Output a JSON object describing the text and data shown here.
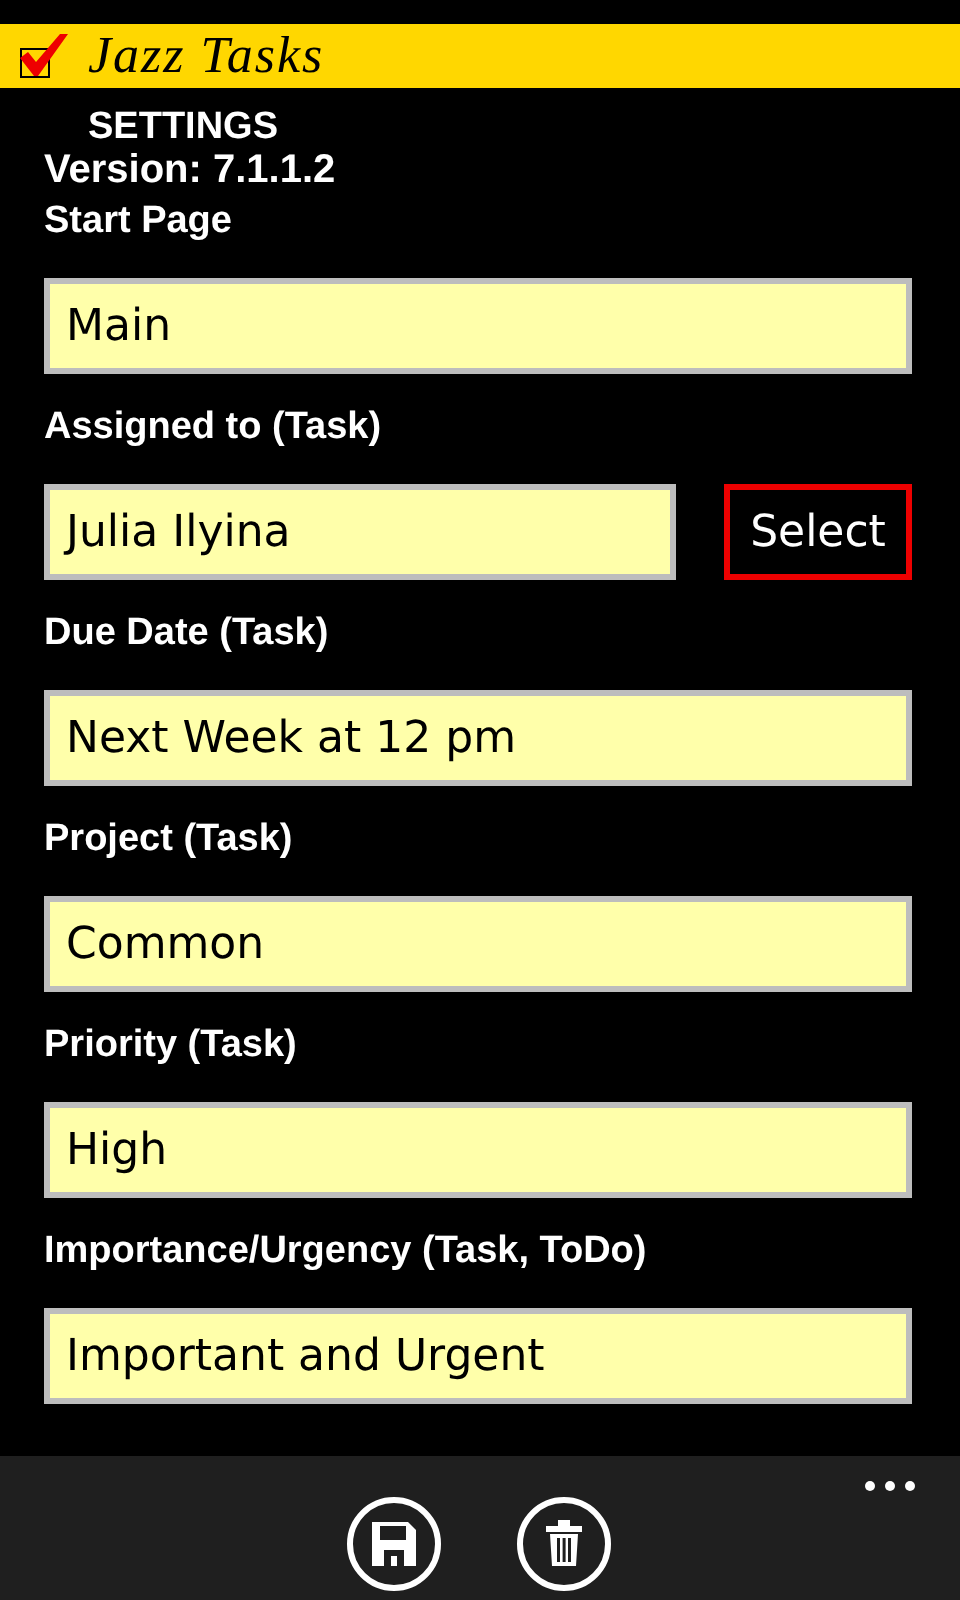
{
  "title_bar": {
    "title": "Jazz Tasks"
  },
  "heading": "SETTINGS",
  "version": "Version: 7.1.1.2",
  "fields": [
    {
      "kind": "text",
      "label": "Start Page",
      "value": "Main"
    },
    {
      "kind": "select",
      "label": "Assigned to (Task)",
      "value": "Julia Ilyina",
      "button": "Select"
    },
    {
      "kind": "text",
      "label": "Due Date (Task)",
      "value": "Next Week at 12 pm"
    },
    {
      "kind": "text",
      "label": "Project (Task)",
      "value": "Common"
    },
    {
      "kind": "text",
      "label": "Priority (Task)",
      "value": "High"
    },
    {
      "kind": "text",
      "label": "Importance/Urgency (Task, ToDo)",
      "value": "Important and Urgent"
    }
  ]
}
